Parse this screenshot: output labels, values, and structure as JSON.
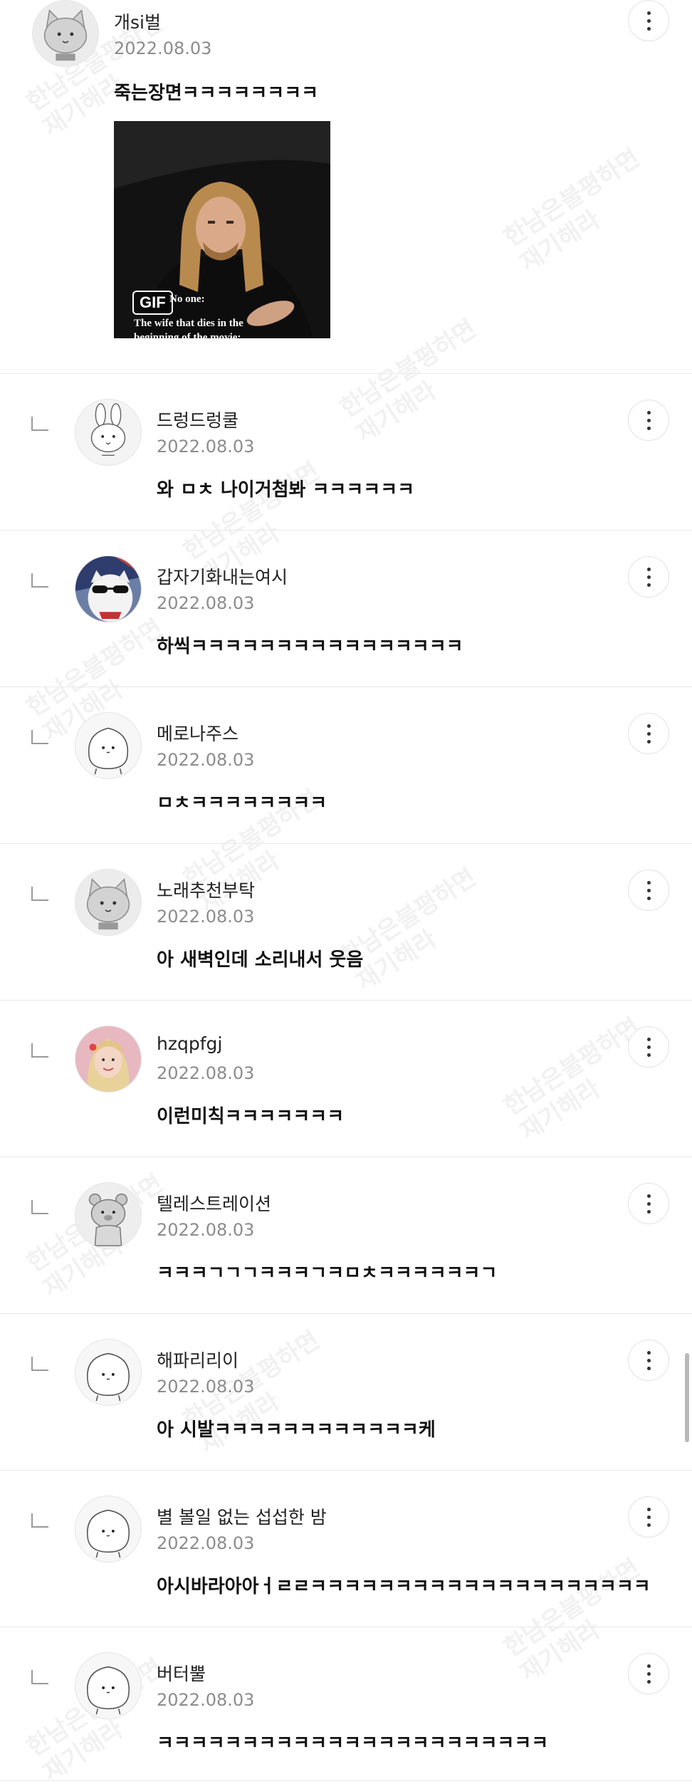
{
  "watermark": {
    "line1": "한남은불평하면",
    "line2": "재기해라"
  },
  "gif": {
    "badge": "GIF",
    "caption1": "No one:",
    "caption2": "The wife that dies in the",
    "caption3": "beginning of the movie:"
  },
  "comments": [
    {
      "nickname": "개si벌",
      "date": "2022.08.03",
      "text": "죽는장면ㅋㅋㅋㅋㅋㅋㅋㅋ",
      "avatar": "gray-cat-avatar"
    },
    {
      "nickname": "드렁드렁쿨",
      "date": "2022.08.03",
      "text": "와 ㅁㅊ 나이거첨봐 ㅋㅋㅋㅋㅋㅋ",
      "avatar": "rabbit-avatar"
    },
    {
      "nickname": "갑자기화내는여시",
      "date": "2022.08.03",
      "text": "하씩ㅋㅋㅋㅋㅋㅋㅋㅋㅋㅋㅋㅋㅋㅋㅋㅋ",
      "avatar": "cat-sunglasses-photo"
    },
    {
      "nickname": "메로나주스",
      "date": "2022.08.03",
      "text": "ㅁㅊㅋㅋㅋㅋㅋㅋㅋㅋ",
      "avatar": "blob-avatar"
    },
    {
      "nickname": "노래추천부탁",
      "date": "2022.08.03",
      "text": "아 새벽인데 소리내서 웃음",
      "avatar": "gray-cat-avatar"
    },
    {
      "nickname": "hzqpfgj",
      "date": "2022.08.03",
      "text": "이런미칙ㅋㅋㅋㅋㅋㅋㅋ",
      "avatar": "blonde-person-photo"
    },
    {
      "nickname": "텔레스트레이션",
      "date": "2022.08.03",
      "text": "ㅋㅋㅋㄱㄱㄱㅋㅋㅋㄱㅋㅁㅊㅋㅋㅋㅋㅋㅋㄱ",
      "avatar": "bear-avatar"
    },
    {
      "nickname": "해파리리이",
      "date": "2022.08.03",
      "text": "아 시발ㅋㅋㅋㅋㅋㅋㅋㅋㅋㅋㅋㅋ케",
      "avatar": "blob-avatar"
    },
    {
      "nickname": "별 볼일 없는 섭섭한 밤",
      "date": "2022.08.03",
      "text": "아시바라아아ㅓㄹㄹㅋㅋㅋㅋㅋㅋㅋㅋㅋㅋㅋㅋㅋㅋㅋㅋㅋㅋㅋㅋ",
      "avatar": "blob-avatar"
    },
    {
      "nickname": "버터뿔",
      "date": "2022.08.03",
      "text": "ㅋㅋㅋㅋㅋㅋㅋㅋㅋㅋㅋㅋㅋㅋㅋㅋㅋㅋㅋㅋㅋㅋㅋ",
      "avatar": "blob-avatar"
    }
  ]
}
